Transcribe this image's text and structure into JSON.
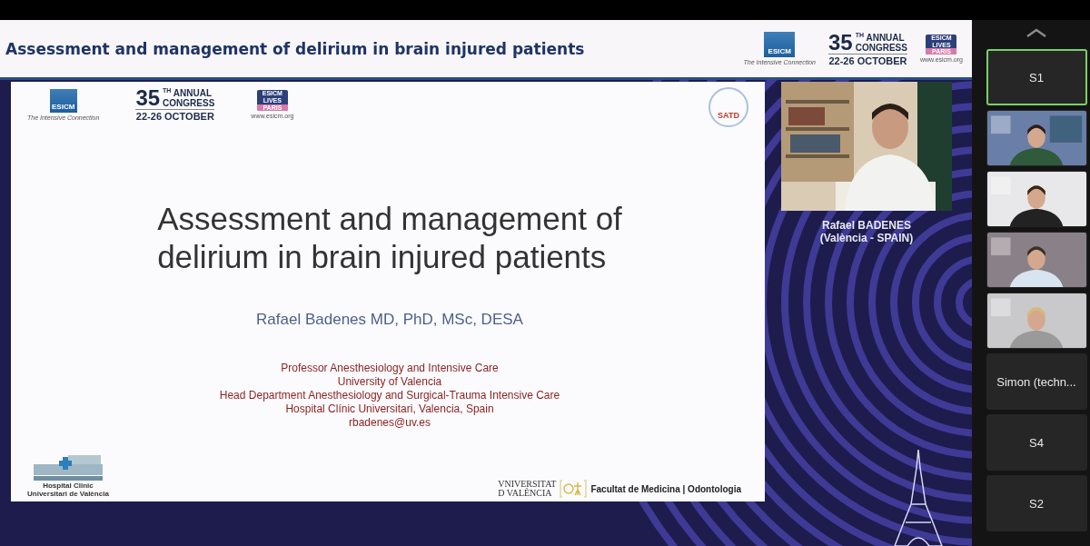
{
  "header": {
    "title": "Assessment and management of delirium in brain injured patients",
    "logo": {
      "society": "ESICM",
      "tagline": "The Intensive Connection",
      "number": "35",
      "ordinal": "TH",
      "line1": "ANNUAL",
      "line2": "CONGRESS",
      "dates": "22-26 OCTOBER",
      "lives": [
        "ESICM",
        "LIVES"
      ],
      "city": "PARIS",
      "site": "www.esicm.org"
    }
  },
  "slide": {
    "logo": {
      "society": "ESICM",
      "tagline": "The Intensive Connection",
      "number": "35",
      "ordinal": "TH",
      "line1": "ANNUAL",
      "line2": "CONGRESS",
      "dates": "22-26 OCTOBER",
      "lives": [
        "ESICM",
        "LIVES"
      ],
      "city": "PARIS",
      "site": "www.esicm.org"
    },
    "badge": "SATD",
    "title": [
      "Assessment and management of",
      "delirium in brain injured patients"
    ],
    "author": "Rafael Badenes MD, PhD, MSc, DESA",
    "affiliation": [
      "Professor Anesthesiology and Intensive Care",
      "University of Valencia",
      "Head Department Anesthesiology and Surgical-Trauma Intensive Care",
      "Hospital Clínic Universitari, Valencia, Spain",
      "rbadenes@uv.es"
    ],
    "hospital": [
      "Hospital Clinic",
      "Universitari de València"
    ],
    "university": [
      "VNIVERSITAT",
      "D VALÈNCIA"
    ],
    "faculty": "Facultat de Medicina | Odontologia"
  },
  "speaker": {
    "name": "Rafael BADENES",
    "place": "(València - SPAIN)"
  },
  "participants": [
    {
      "kind": "name",
      "label": "S1",
      "selected": true
    },
    {
      "kind": "picture",
      "selected": false
    },
    {
      "kind": "picture",
      "selected": false
    },
    {
      "kind": "picture",
      "selected": false
    },
    {
      "kind": "picture",
      "selected": false
    },
    {
      "kind": "name",
      "label": "Simon (techn...",
      "selected": false
    },
    {
      "kind": "name",
      "label": "S4",
      "selected": false
    },
    {
      "kind": "name",
      "label": "S2",
      "selected": false
    }
  ]
}
